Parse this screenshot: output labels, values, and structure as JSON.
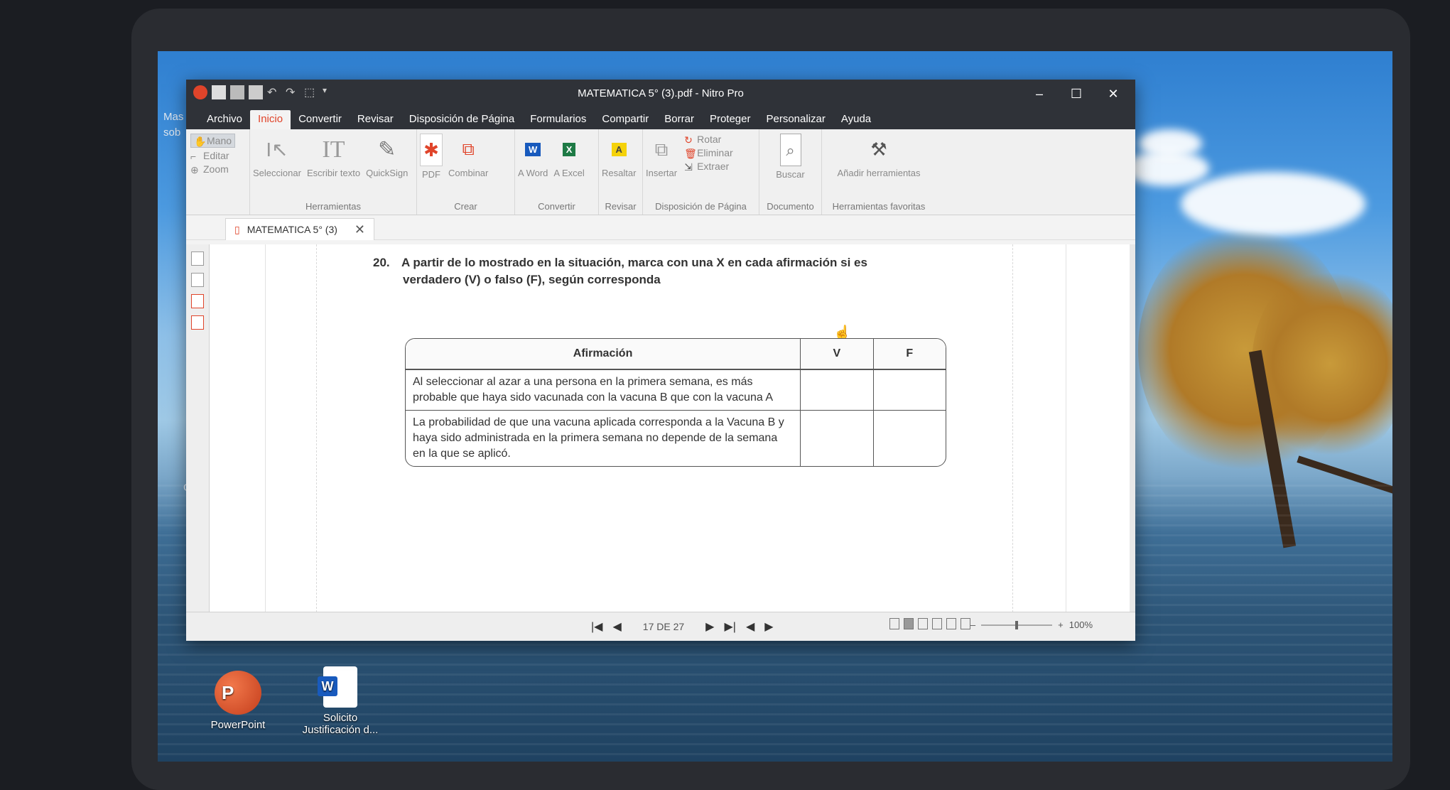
{
  "window": {
    "title": "MATEMATICA 5° (3).pdf - Nitro Pro",
    "controls": [
      "–",
      "☐",
      "✕"
    ]
  },
  "menu": {
    "items": [
      "Archivo",
      "Inicio",
      "Convertir",
      "Revisar",
      "Disposición de Página",
      "Formularios",
      "Compartir",
      "Borrar",
      "Proteger",
      "Personalizar",
      "Ayuda"
    ],
    "active": "Inicio"
  },
  "ribbon": {
    "nav_tools": [
      "Mano",
      "Editar",
      "Zoom"
    ],
    "herramientas": {
      "buttons": [
        "Seleccionar",
        "Escribir texto",
        "QuickSign"
      ],
      "label": "Herramientas"
    },
    "crear": {
      "buttons": [
        "PDF",
        "Combinar"
      ],
      "label": "Crear"
    },
    "convertir": {
      "buttons": [
        "A Word",
        "A Excel"
      ],
      "label": "Convertir"
    },
    "revisar": {
      "buttons": [
        "Resaltar"
      ],
      "label": "Revisar"
    },
    "disposicion": {
      "buttons": [
        "Insertar"
      ],
      "small": [
        "Rotar",
        "Eliminar",
        "Extraer"
      ],
      "label": "Disposición de Página"
    },
    "documento": {
      "buttons": [
        "Buscar"
      ],
      "label": "Documento"
    },
    "favoritas": {
      "buttons": [
        "Añadir herramientas"
      ],
      "label": "Herramientas favoritas"
    }
  },
  "tab": {
    "label": "MATEMATICA 5° (3)"
  },
  "document": {
    "question_number": "20.",
    "question_line1": "A partir de lo mostrado en la situación, marca con una X en cada afirmación si es",
    "question_line2": "verdadero (V) o falso (F), según corresponda",
    "table": {
      "headers": [
        "Afirmación",
        "V",
        "F"
      ],
      "rows": [
        [
          "Al seleccionar al azar a una persona en la primera semana, es más probable que haya sido vacunada con la vacuna B que con la vacuna A",
          "",
          ""
        ],
        [
          "La probabilidad de que una vacuna aplicada corresponda a la Vacuna B y haya sido administrada en la primera semana no depende de la semana en la que se aplicó.",
          "",
          ""
        ]
      ]
    }
  },
  "status": {
    "page": "17 DE 27",
    "zoom": "100%"
  },
  "desktop": {
    "icons": [
      {
        "label": "PowerPoint"
      },
      {
        "label": "Solicito Justificación d..."
      }
    ],
    "side_fragments": [
      "Mas",
      "sob",
      "Go"
    ]
  },
  "colors": {
    "titlebar": "#2f3238",
    "accent": "#e0442a",
    "word": "#185abd",
    "excel": "#1e7a45"
  }
}
